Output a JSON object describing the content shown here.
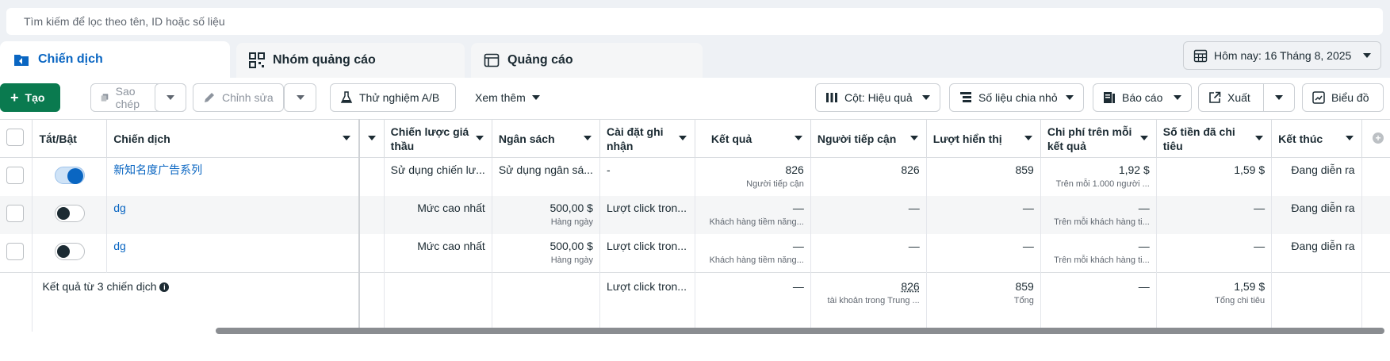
{
  "search": {
    "placeholder": "Tìm kiếm để lọc theo tên, ID hoặc số liệu"
  },
  "tabs": [
    {
      "label": "Chiến dịch",
      "icon": "folder-icon"
    },
    {
      "label": "Nhóm quảng cáo",
      "icon": "grid-icon"
    },
    {
      "label": "Quảng cáo",
      "icon": "ad-icon"
    }
  ],
  "date_range": {
    "label": "Hôm nay: 16 Tháng 8, 2025"
  },
  "toolbar": {
    "create": "Tạo",
    "duplicate": "Sao chép",
    "edit": "Chỉnh sửa",
    "ab_test": "Thử nghiệm A/B",
    "more": "Xem thêm",
    "columns": "Cột: Hiệu quả",
    "breakdown": "Số liệu chia nhỏ",
    "reports": "Báo cáo",
    "export": "Xuất",
    "chart": "Biểu đồ"
  },
  "columns": {
    "toggle": "Tắt/Bật",
    "campaign": "Chiến dịch",
    "bid_strategy": "Chiến lược giá thầu",
    "budget": "Ngân sách",
    "attribution": "Cài đặt ghi nhận",
    "results": "Kết quả",
    "reach": "Người tiếp cận",
    "impressions": "Lượt hiển thị",
    "cost_per_result": "Chi phí trên mỗi kết quả",
    "amount_spent": "Số tiền đã chi tiêu",
    "ends": "Kết thúc"
  },
  "rows": [
    {
      "on": true,
      "name": "新知名度广告系列",
      "bid_strategy": "Sử dụng chiến lư...",
      "budget": "Sử dụng ngân sá...",
      "budget_sub": "",
      "attribution": "-",
      "results": "826",
      "results_sub": "Người tiếp cận",
      "reach": "826",
      "impressions": "859",
      "cost_per_result": "1,92 $",
      "cost_sub": "Trên mỗi 1.000 người ...",
      "amount_spent": "1,59 $",
      "ends": "Đang diễn ra"
    },
    {
      "on": false,
      "name": "dg",
      "bid_strategy": "Mức cao nhất",
      "budget": "500,00 $",
      "budget_sub": "Hàng ngày",
      "attribution": "Lượt click tron...",
      "results": "—",
      "results_sub": "Khách hàng tiềm năng...",
      "reach": "—",
      "impressions": "—",
      "cost_per_result": "—",
      "cost_sub": "Trên mỗi khách hàng ti...",
      "amount_spent": "—",
      "ends": "Đang diễn ra"
    },
    {
      "on": false,
      "name": "dg",
      "bid_strategy": "Mức cao nhất",
      "budget": "500,00 $",
      "budget_sub": "Hàng ngày",
      "attribution": "Lượt click tron...",
      "results": "—",
      "results_sub": "Khách hàng tiềm năng...",
      "reach": "—",
      "impressions": "—",
      "cost_per_result": "—",
      "cost_sub": "Trên mỗi khách hàng ti...",
      "amount_spent": "—",
      "ends": "Đang diễn ra"
    }
  ],
  "summary": {
    "label": "Kết quả từ 3 chiến dịch",
    "attribution": "Lượt click tron...",
    "results": "—",
    "reach": "826",
    "reach_sub": "tài khoản trong Trung ...",
    "impressions": "859",
    "impressions_sub": "Tổng",
    "cost_per_result": "—",
    "amount_spent": "1,59 $",
    "amount_spent_sub": "Tổng chi tiêu"
  },
  "colors": {
    "accent": "#0a66c2",
    "create_button": "#0a7a4f"
  }
}
